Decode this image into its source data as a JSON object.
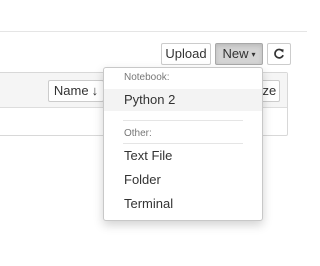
{
  "toolbar": {
    "upload_label": "Upload",
    "new_label": "New",
    "caret_glyph": "▾",
    "refresh_icon": "refresh-icon"
  },
  "file_list": {
    "sort_name_label": "Name",
    "sort_arrow": "🡓",
    "size_label": "Size"
  },
  "new_menu": {
    "notebook_header": "Notebook:",
    "python2_label": "Python 2",
    "other_header": "Other:",
    "text_file_label": "Text File",
    "folder_label": "Folder",
    "terminal_label": "Terminal"
  }
}
